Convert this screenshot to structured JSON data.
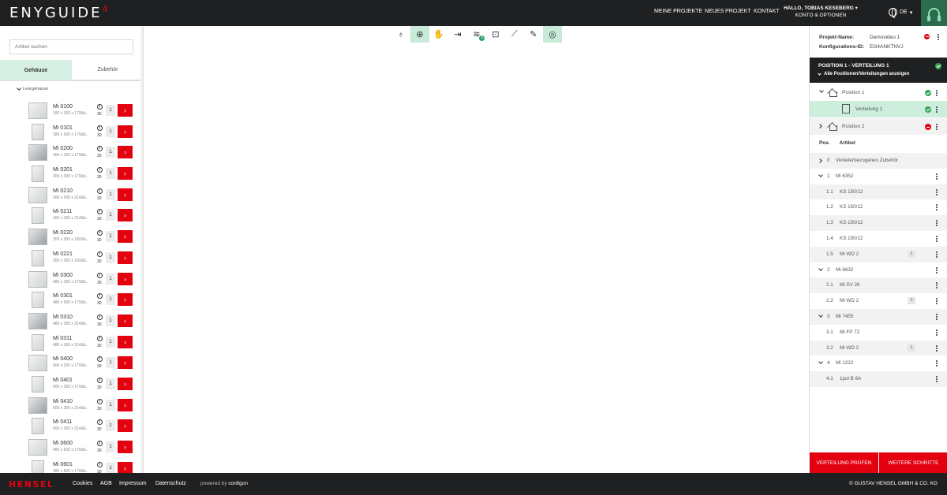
{
  "header": {
    "logo_main": "ENYGUIDE",
    "logo_sup": "4",
    "nav": [
      "MEINE PROJEKTE",
      "NEUES PROJEKT",
      "KONTAKT"
    ],
    "user_greeting": "HALLO, TOBIAS KESEBERG",
    "user_sub": "KONTO & OPTIONEN",
    "language": "DE",
    "help_icon": "headset-icon"
  },
  "left": {
    "search_placeholder": "Artikel suchen",
    "tabs": [
      "Gehäuse",
      "Zubehör"
    ],
    "active_tab": "Gehäuse",
    "category": "Leergehäuse",
    "products": [
      {
        "name": "Mi 0100",
        "dims": "180 x 300 x 170&b...",
        "count": "30",
        "qty": "1"
      },
      {
        "name": "Mi 0101",
        "dims": "180 x 300 x 170&b...",
        "count": "30",
        "qty": "1"
      },
      {
        "name": "Mi 0200",
        "dims": "300 x 300 x 170&b...",
        "count": "30",
        "qty": "1"
      },
      {
        "name": "Mi 0201",
        "dims": "300 x 300 x 170&b...",
        "count": "30",
        "qty": "1"
      },
      {
        "name": "Mi 0210",
        "dims": "300 x 300 x 214&b...",
        "count": "30",
        "qty": "1"
      },
      {
        "name": "Mi 0211",
        "dims": "300 x 300 x 214&b...",
        "count": "30",
        "qty": "1"
      },
      {
        "name": "Mi 0220",
        "dims": "300 x 300 x 182&b...",
        "count": "30",
        "qty": "1"
      },
      {
        "name": "Mi 0221",
        "dims": "300 x 300 x 182&b...",
        "count": "30",
        "qty": "1"
      },
      {
        "name": "Mi 0300",
        "dims": "480 x 300 x 170&b...",
        "count": "30",
        "qty": "1"
      },
      {
        "name": "Mi 0301",
        "dims": "480 x 300 x 170&b...",
        "count": "30",
        "qty": "1"
      },
      {
        "name": "Mi 0310",
        "dims": "480 x 300 x 214&b...",
        "count": "30",
        "qty": "1"
      },
      {
        "name": "Mi 0311",
        "dims": "480 x 300 x 214&b...",
        "count": "30",
        "qty": "1"
      },
      {
        "name": "Mi 0400",
        "dims": "600 x 300 x 170&b...",
        "count": "30",
        "qty": "1"
      },
      {
        "name": "Mi 0401",
        "dims": "600 x 300 x 170&b...",
        "count": "30",
        "qty": "1"
      },
      {
        "name": "Mi 0410",
        "dims": "600 x 300 x 214&b...",
        "count": "30",
        "qty": "1"
      },
      {
        "name": "Mi 0411",
        "dims": "600 x 300 x 214&b...",
        "count": "30",
        "qty": "1"
      },
      {
        "name": "Mi 0600",
        "dims": "480 x 600 x 170&b...",
        "count": "30",
        "qty": "1"
      },
      {
        "name": "Mi 0601",
        "dims": "480 x 600 x 170&b...",
        "count": "30",
        "qty": "1"
      }
    ]
  },
  "toolbar": {
    "tools": [
      {
        "icon": "joystick-icon",
        "glyph": "♁",
        "active": false
      },
      {
        "icon": "rotate-view-icon",
        "glyph": "⊕",
        "active": true
      },
      {
        "icon": "hand-pan-icon",
        "glyph": "✋",
        "active": false
      },
      {
        "icon": "move-in-icon",
        "glyph": "⇥",
        "active": false
      },
      {
        "icon": "layers-icon",
        "glyph": "≋",
        "active": false,
        "badge": "3"
      },
      {
        "icon": "fit-screen-icon",
        "glyph": "⊡",
        "active": false
      },
      {
        "icon": "measure-icon",
        "glyph": "⟋",
        "active": false
      },
      {
        "icon": "edit-icon",
        "glyph": "✎",
        "active": false
      },
      {
        "icon": "target-icon",
        "glyph": "◎",
        "active": true
      }
    ]
  },
  "project": {
    "name_label": "Projekt-Name:",
    "name_value": "Demovideo 1",
    "config_label": "Konfigurations-ID:",
    "config_value": "EG4ANKTNVJ"
  },
  "position_header": {
    "title": "POSITION 1 - VERTEILUNG 1",
    "toggle": "Alle Positionen/Verteilungen anzeigen"
  },
  "positions": [
    {
      "label": "Position 1",
      "status": "ok"
    },
    {
      "label": "Verteilung 1",
      "status": "ok"
    },
    {
      "label": "Position 2",
      "status": "error"
    }
  ],
  "article_table": {
    "col_pos": "Pos.",
    "col_article": "Artikel",
    "rows": [
      {
        "num": "0",
        "name": "Verteilerbezogenes Zubehör",
        "level": 0,
        "chev": "right",
        "qty": "",
        "shade": true
      },
      {
        "num": "1",
        "name": "Mi 6352",
        "level": 0,
        "chev": "down",
        "qty": "",
        "shade": false
      },
      {
        "num": "1.1",
        "name": "KS 150/12",
        "level": 1,
        "chev": "",
        "qty": "",
        "shade": true
      },
      {
        "num": "1.2",
        "name": "KS 150/12",
        "level": 1,
        "chev": "",
        "qty": "",
        "shade": false
      },
      {
        "num": "1.3",
        "name": "KS 150/12",
        "level": 1,
        "chev": "",
        "qty": "",
        "shade": true
      },
      {
        "num": "1.4",
        "name": "KS 150/12",
        "level": 1,
        "chev": "",
        "qty": "",
        "shade": false
      },
      {
        "num": "1.5",
        "name": "Mi WD 2",
        "level": 1,
        "chev": "",
        "qty": "1",
        "shade": true
      },
      {
        "num": "2",
        "name": "Mi 6632",
        "level": 0,
        "chev": "down",
        "qty": "",
        "shade": false
      },
      {
        "num": "2.1",
        "name": "Mi SV 26",
        "level": 1,
        "chev": "",
        "qty": "",
        "shade": true
      },
      {
        "num": "2.2",
        "name": "Mi WD 2",
        "level": 1,
        "chev": "",
        "qty": "1",
        "shade": false
      },
      {
        "num": "3",
        "name": "Mi 7455",
        "level": 0,
        "chev": "down",
        "qty": "",
        "shade": true
      },
      {
        "num": "3.1",
        "name": "Mi FP 72",
        "level": 1,
        "chev": "",
        "qty": "",
        "shade": false
      },
      {
        "num": "3.2",
        "name": "Mi WD 2",
        "level": 1,
        "chev": "",
        "qty": "1",
        "shade": true
      },
      {
        "num": "4",
        "name": "Mi 1222",
        "level": 0,
        "chev": "down",
        "qty": "",
        "shade": false
      },
      {
        "num": "4.1",
        "name": "1pol B 6A",
        "level": 1,
        "chev": "",
        "qty": "",
        "shade": true
      }
    ]
  },
  "actions": {
    "check": "VERTEILUNG PRÜFEN",
    "next": "WEITERE SCHRITTE"
  },
  "footer": {
    "logo": "HENSEL",
    "links": [
      "Cookies",
      "AGB",
      "Impressum",
      "Datenschutz"
    ],
    "powered_prefix": "powered by",
    "powered_brand": "configon",
    "copyright": "© GUSTAV HENSEL GMBH & CO. KG"
  },
  "colors": {
    "brand_red": "#e3000f",
    "dark_bar": "#1f2021",
    "active_green": "#c7ebd8",
    "ok_green": "#2ea44f",
    "grid_blue": "#9fd3ec"
  }
}
